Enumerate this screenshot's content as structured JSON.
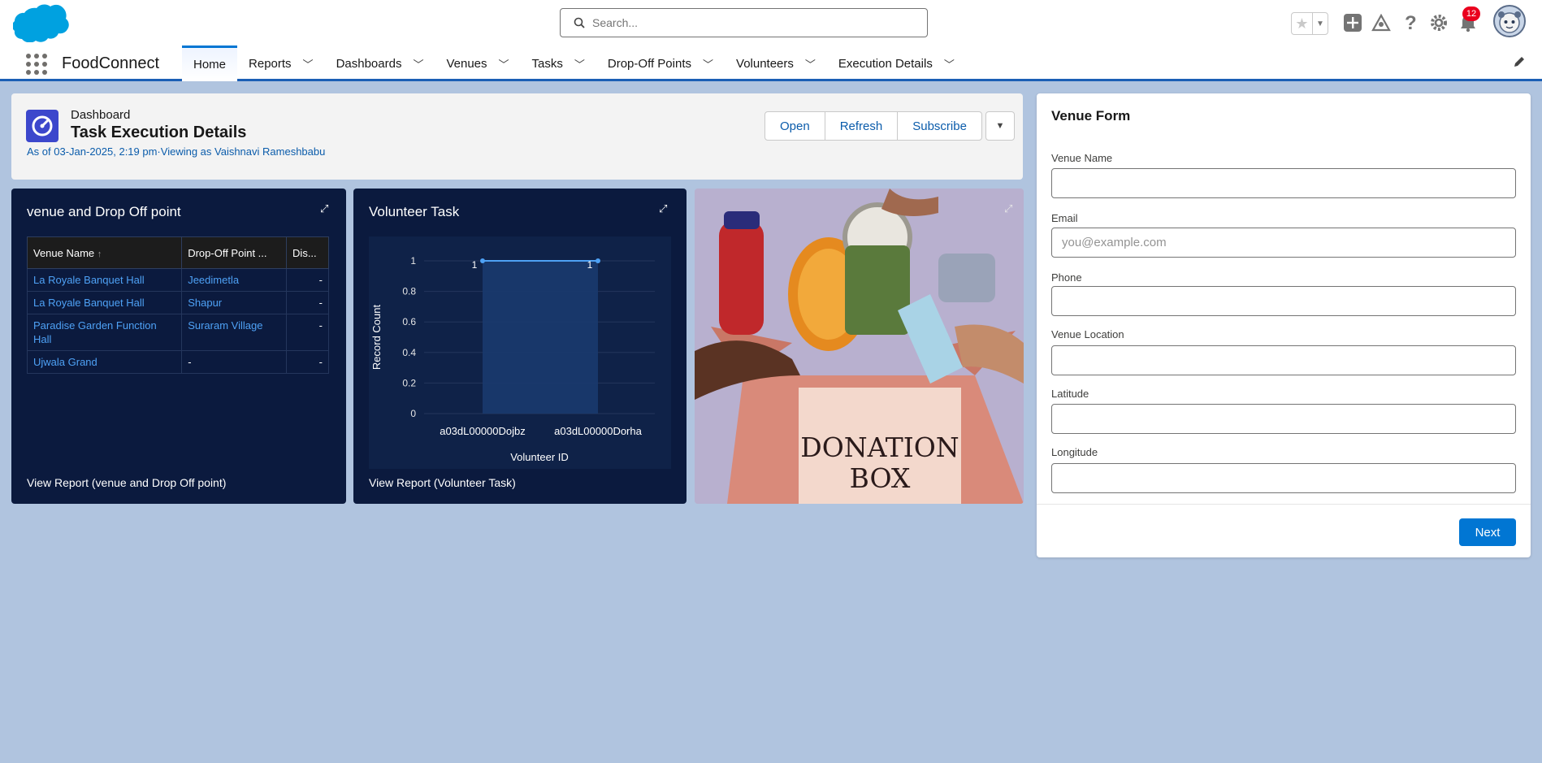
{
  "header": {
    "search_placeholder": "Search...",
    "notification_count": "12"
  },
  "nav": {
    "app_name": "FoodConnect",
    "items": [
      {
        "label": "Home",
        "active": true
      },
      {
        "label": "Reports"
      },
      {
        "label": "Dashboards"
      },
      {
        "label": "Venues"
      },
      {
        "label": "Tasks"
      },
      {
        "label": "Drop-Off Points"
      },
      {
        "label": "Volunteers"
      },
      {
        "label": "Execution Details"
      }
    ]
  },
  "dashboard": {
    "type": "Dashboard",
    "title": "Task Execution Details",
    "subtitle": "As of 03-Jan-2025, 2:19 pm·Viewing as Vaishnavi Rameshbabu",
    "buttons": {
      "open": "Open",
      "refresh": "Refresh",
      "subscribe": "Subscribe"
    }
  },
  "venue_widget": {
    "title": "venue and Drop Off point",
    "columns": [
      "Venue Name",
      "Drop-Off Point ...",
      "Dis..."
    ],
    "rows": [
      [
        "La Royale Banquet Hall",
        "Jeedimetla",
        "-"
      ],
      [
        "La Royale Banquet Hall",
        "Shapur",
        "-"
      ],
      [
        "Paradise Garden Function Hall",
        "Suraram Village",
        "-"
      ],
      [
        "Ujwala Grand",
        "-",
        "-"
      ]
    ],
    "report_link": "View Report (venue and Drop Off point)"
  },
  "volunteer_widget": {
    "title": "Volunteer Task",
    "report_link": "View Report (Volunteer Task)"
  },
  "chart_data": {
    "type": "line",
    "categories": [
      "a03dL00000Dojbz",
      "a03dL00000Dorha"
    ],
    "values": [
      1,
      1
    ],
    "data_labels": [
      "1",
      "1"
    ],
    "xlabel": "Volunteer ID",
    "ylabel": "Record Count",
    "ylim": [
      0,
      1
    ],
    "yticks": [
      "0",
      "0.2",
      "0.4",
      "0.6",
      "0.8",
      "1"
    ],
    "grid": true,
    "colors": {
      "line": "#4ea1f5",
      "area": "#1a3a6e"
    }
  },
  "image_widget": {
    "box_text_line1": "DONATION",
    "box_text_line2": "BOX"
  },
  "form": {
    "title": "Venue Form",
    "fields": [
      {
        "label": "Venue Name",
        "value": "",
        "placeholder": ""
      },
      {
        "label": "Email",
        "value": "",
        "placeholder": "you@example.com"
      },
      {
        "label": "Phone",
        "value": "",
        "placeholder": ""
      },
      {
        "label": "Venue Location",
        "value": "",
        "placeholder": ""
      },
      {
        "label": "Latitude",
        "value": "",
        "placeholder": ""
      },
      {
        "label": "Longitude",
        "value": "",
        "placeholder": ""
      }
    ],
    "next_label": "Next"
  },
  "colors": {
    "brand": "#0176d3",
    "nav_underline": "#1b5fb5",
    "widget_bg": "#0b1a3e",
    "page_bg": "#b0c4df"
  }
}
